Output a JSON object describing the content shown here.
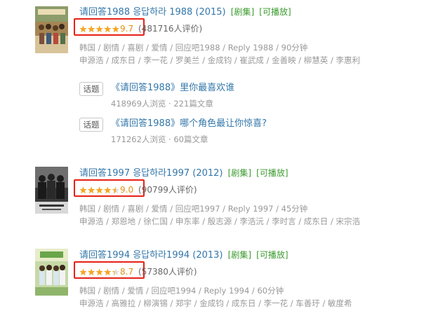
{
  "results": [
    {
      "title": "请回答1988 응답하라 1988 (2015)",
      "tags": [
        "[剧集]",
        "[可播放]"
      ],
      "score": 9.7,
      "score_text": "9.7",
      "rating_count": "(481716人评价)",
      "meta": [
        "韩国 / 剧情 / 喜剧 / 爱情 / 回应吧1988 / Reply 1988 / 90分钟",
        "申源浩 / 成东日 / 李一花 / 罗美兰 / 金成钧 / 崔武成 / 金善映 / 柳慧英 / 李惠利"
      ],
      "topics": [
        {
          "badge": "话题",
          "title": "《请回答1988》里你最喜欢谁",
          "stats": "418969人浏览 · 221篇文章"
        },
        {
          "badge": "话题",
          "title": "《请回答1988》哪个角色最让你惊喜?",
          "stats": "171262人浏览 · 60篇文章"
        }
      ]
    },
    {
      "title": "请回答1997 응답하라1997 (2012)",
      "tags": [
        "[剧集]",
        "[可播放]"
      ],
      "score": 9.0,
      "score_text": "9.0",
      "rating_count": "(90799人评价)",
      "meta": [
        "韩国 / 剧情 / 喜剧 / 爱情 / 回应吧1997 / Reply 1997 / 45分钟",
        "申源浩 / 郑恩地 / 徐仁国 / 申东率 / 殷志源 / 李浩沅 / 李时言 / 成东日 / 宋宗浩"
      ],
      "topics": []
    },
    {
      "title": "请回答1994 응답하라1994 (2013)",
      "tags": [
        "[剧集]",
        "[可播放]"
      ],
      "score": 8.7,
      "score_text": "8.7",
      "rating_count": "(57380人评价)",
      "meta": [
        "韩国 / 剧情 / 爱情 / 回应吧1994 / Reply 1994 / 60分钟",
        "申源浩 / 高雅拉 / 柳演锡 / 郑宇 / 金成钧 / 成东日 / 李一花 / 车善玗 / 敏度希"
      ],
      "topics": []
    }
  ],
  "colors": {
    "link": "#3377aa",
    "tag": "#3b9a2e",
    "star": "#f5a623",
    "star_empty": "#dddddd",
    "highlight_box": "#e62117",
    "meta": "#999999"
  }
}
